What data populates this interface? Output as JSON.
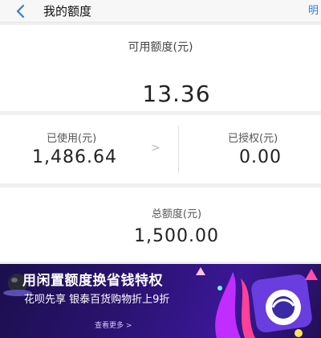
{
  "header": {
    "title": "我的额度",
    "right_link": "明"
  },
  "available": {
    "label": "可用额度(元)",
    "value": "13.36"
  },
  "used": {
    "label": "已使用(元)",
    "value": "1,486.64",
    "chevron": ">"
  },
  "authorized": {
    "label": "已授权(元)",
    "value": "0.00"
  },
  "total": {
    "label": "总额度(元)",
    "value": "1,500.00"
  },
  "banner": {
    "title": "用闲置额度换省钱特权",
    "subtitle": "花呗先享 银泰百货购物折上9折",
    "link": "查看更多 >"
  },
  "colors": {
    "accent_link": "#2f7fd6",
    "banner_bg": "#2a1370"
  }
}
